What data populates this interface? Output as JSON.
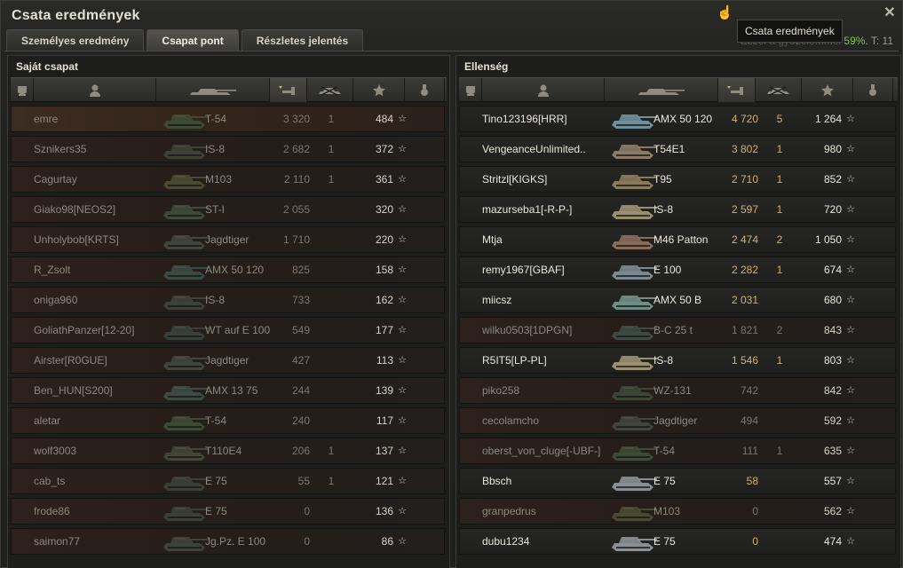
{
  "window": {
    "title": "Csata eredmények",
    "close_label": "✕"
  },
  "tooltip": {
    "text": "Csata eredmények"
  },
  "score_line": {
    "prefix": "Ezzel a győzelemmel",
    "pct": "59%.",
    "t_label": "T: 11"
  },
  "tabs": [
    {
      "label": "Személyes eredmény",
      "active": false
    },
    {
      "label": "Csapat pont",
      "active": true
    },
    {
      "label": "Részletes jelentés",
      "active": false
    }
  ],
  "columns": {
    "icons": [
      "squad-icon",
      "player-icon",
      "vehicle-icon",
      "damage-icon",
      "kills-icon",
      "xp-star-icon",
      "medal-icon"
    ]
  },
  "colors": {
    "accent_green": "#7fc44a",
    "damage_gold": "#d3b06c",
    "dead_row": "#2c211c"
  },
  "left_team": {
    "title": "Saját csapat",
    "players": [
      {
        "name": "emre",
        "vehicle": "T-54",
        "damage": "3 320",
        "kills": "1",
        "xp": "484",
        "dead": true,
        "tank_color": "#3d4a34"
      },
      {
        "name": "Sznikers35",
        "vehicle": "IS-8",
        "damage": "2 682",
        "kills": "1",
        "xp": "372",
        "dead": true,
        "tank_color": "#3e4236"
      },
      {
        "name": "Cagurtay",
        "vehicle": "M103",
        "damage": "2 110",
        "kills": "1",
        "xp": "361",
        "dead": true,
        "tank_color": "#4a4a32"
      },
      {
        "name": "Giako98[NEOS2]",
        "vehicle": "ST-I",
        "damage": "2 055",
        "kills": "",
        "xp": "320",
        "dead": true,
        "tank_color": "#3d4a3a"
      },
      {
        "name": "Unholybob[KRTS]",
        "vehicle": "Jagdtiger",
        "damage": "1 710",
        "kills": "",
        "xp": "220",
        "dead": true,
        "tank_color": "#41453d"
      },
      {
        "name": "R_Zsolt",
        "vehicle": "AMX 50 120",
        "damage": "825",
        "kills": "",
        "xp": "158",
        "dead": true,
        "tank_color": "#3a4a44"
      },
      {
        "name": "oniga960",
        "vehicle": "IS-8",
        "damage": "733",
        "kills": "",
        "xp": "162",
        "dead": true,
        "tank_color": "#3e4236"
      },
      {
        "name": "GoliathPanzer[12-20]",
        "vehicle": "WT auf E 100",
        "damage": "549",
        "kills": "",
        "xp": "177",
        "dead": true,
        "tank_color": "#3a3f3c"
      },
      {
        "name": "Airster[R0GUE]",
        "vehicle": "Jagdtiger",
        "damage": "427",
        "kills": "",
        "xp": "113",
        "dead": true,
        "tank_color": "#41453d"
      },
      {
        "name": "Ben_HUN[S200]",
        "vehicle": "AMX 13 75",
        "damage": "244",
        "kills": "",
        "xp": "139",
        "dead": true,
        "tank_color": "#3e4a44"
      },
      {
        "name": "aletar",
        "vehicle": "T-54",
        "damage": "240",
        "kills": "",
        "xp": "117",
        "dead": true,
        "tank_color": "#3d4a34"
      },
      {
        "name": "wolf3003",
        "vehicle": "T110E4",
        "damage": "206",
        "kills": "1",
        "xp": "137",
        "dead": true,
        "tank_color": "#434636"
      },
      {
        "name": "cab_ts",
        "vehicle": "E 75",
        "damage": "55",
        "kills": "1",
        "xp": "121",
        "dead": true,
        "tank_color": "#3b3f38"
      },
      {
        "name": "frode86",
        "vehicle": "E 75",
        "damage": "0",
        "kills": "",
        "xp": "136",
        "dead": true,
        "tank_color": "#3b3f38"
      },
      {
        "name": "saimon77",
        "vehicle": "Jg.Pz. E 100",
        "damage": "0",
        "kills": "",
        "xp": "86",
        "dead": true,
        "tank_color": "#3f4238"
      }
    ]
  },
  "right_team": {
    "title": "Ellenség",
    "players": [
      {
        "name": "Tino123196[HRR]",
        "vehicle": "AMX 50 120",
        "damage": "4 720",
        "kills": "5",
        "xp": "1 264",
        "dead": false,
        "tank_color": "#6f8f9a"
      },
      {
        "name": "VengeanceUnlimited..",
        "vehicle": "T54E1",
        "damage": "3 802",
        "kills": "1",
        "xp": "980",
        "dead": false,
        "tank_color": "#8a7a66"
      },
      {
        "name": "Stritzl[KIGKS]",
        "vehicle": "T95",
        "damage": "2 710",
        "kills": "1",
        "xp": "852",
        "dead": false,
        "tank_color": "#8a7a5c"
      },
      {
        "name": "mazurseba1[-R-P-]",
        "vehicle": "IS-8",
        "damage": "2 597",
        "kills": "1",
        "xp": "720",
        "dead": false,
        "tank_color": "#9a9070"
      },
      {
        "name": "Mtja",
        "vehicle": "M46 Patton",
        "damage": "2 474",
        "kills": "2",
        "xp": "1 050",
        "dead": false,
        "tank_color": "#8a6a58"
      },
      {
        "name": "remy1967[GBAF]",
        "vehicle": "E 100",
        "damage": "2 282",
        "kills": "1",
        "xp": "674",
        "dead": false,
        "tank_color": "#7a8a90"
      },
      {
        "name": "miicsz",
        "vehicle": "AMX 50 B",
        "damage": "2 031",
        "kills": "",
        "xp": "680",
        "dead": false,
        "tank_color": "#6f8f86"
      },
      {
        "name": "wilku0503[1DPGN]",
        "vehicle": "B-C 25 t",
        "damage": "1 821",
        "kills": "2",
        "xp": "843",
        "dead": true,
        "tank_color": "#3e4a44"
      },
      {
        "name": "R5IT5[LP-PL]",
        "vehicle": "IS-8",
        "damage": "1 546",
        "kills": "1",
        "xp": "803",
        "dead": false,
        "tank_color": "#9a9070"
      },
      {
        "name": "piko258",
        "vehicle": "WZ-131",
        "damage": "742",
        "kills": "",
        "xp": "842",
        "dead": true,
        "tank_color": "#3d4636"
      },
      {
        "name": "cecolamcho",
        "vehicle": "Jagdtiger",
        "damage": "494",
        "kills": "",
        "xp": "592",
        "dead": true,
        "tank_color": "#41453d"
      },
      {
        "name": "oberst_von_cluge[-UBF-]",
        "vehicle": "T-54",
        "damage": "111",
        "kills": "1",
        "xp": "635",
        "dead": true,
        "tank_color": "#3d4a34"
      },
      {
        "name": "Bbsch",
        "vehicle": "E 75",
        "damage": "58",
        "kills": "",
        "xp": "557",
        "dead": false,
        "tank_color": "#8a8f94"
      },
      {
        "name": "granpedrus",
        "vehicle": "M103",
        "damage": "0",
        "kills": "",
        "xp": "562",
        "dead": true,
        "tank_color": "#4a4a32"
      },
      {
        "name": "dubu1234",
        "vehicle": "E 75",
        "damage": "0",
        "kills": "",
        "xp": "474",
        "dead": false,
        "tank_color": "#8a8f94"
      }
    ]
  }
}
